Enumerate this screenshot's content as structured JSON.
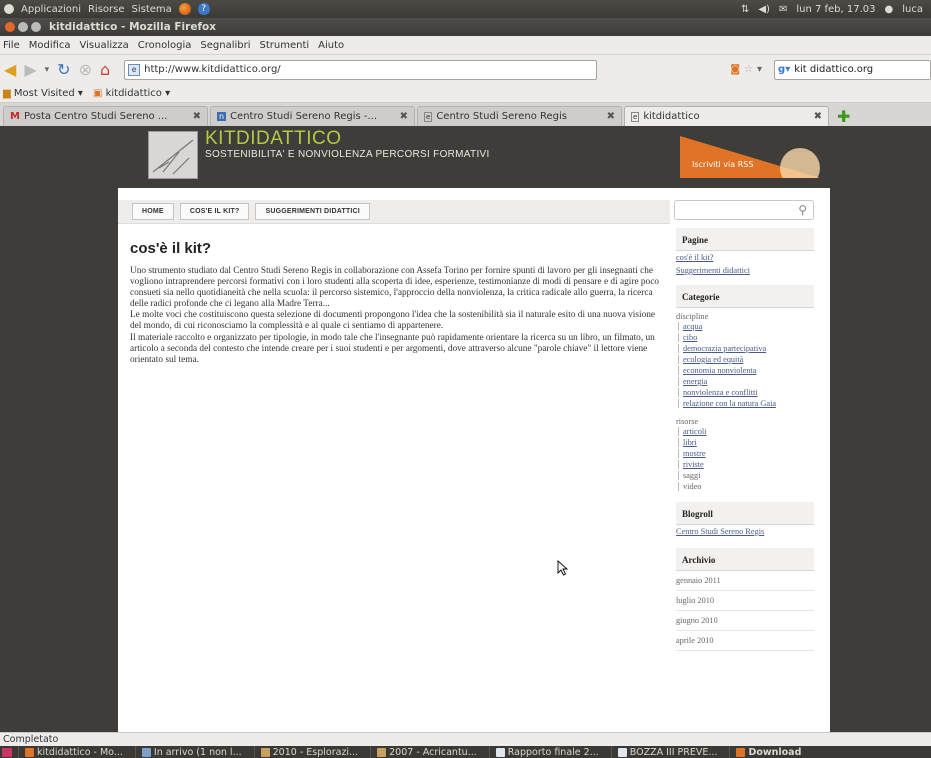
{
  "top_panel": {
    "menus": [
      "Applicazioni",
      "Risorse",
      "Sistema"
    ],
    "clock": "lun 7 feb, 17.03",
    "user": "luca"
  },
  "window": {
    "title": "kitdidattico - Mozilla Firefox"
  },
  "menubar": [
    "File",
    "Modifica",
    "Visualizza",
    "Cronologia",
    "Segnalibri",
    "Strumenti",
    "Aiuto"
  ],
  "navbar": {
    "url": "http://www.kitdidattico.org/",
    "search_value": "kit didattico.org"
  },
  "bookmarks": [
    {
      "label": "Most Visited ▾"
    },
    {
      "label": "kitdidattico ▾"
    }
  ],
  "tabs": [
    {
      "label": "Posta Centro Studi Sereno ...",
      "active": false
    },
    {
      "label": "Centro Studi Sereno Regis -...",
      "active": false
    },
    {
      "label": "Centro Studi Sereno Regis",
      "active": false
    },
    {
      "label": "kitdidattico",
      "active": true
    }
  ],
  "site": {
    "title": "KITDIDATTICO",
    "subtitle": "SOSTENIBILITA' E NONVIOLENZA  PERCORSI FORMATIVI",
    "rss_label": "Iscriviti via RSS",
    "nav": [
      "HOME",
      "COS'E IL KIT?",
      "SUGGERIMENTI DIDATTICI"
    ],
    "page_title": "cos'è il kit?",
    "body_paragraphs": [
      "Uno strumento studiato dal Centro Studi Sereno Regis in collaborazione con Assefa Torino per fornire spunti di lavoro per gli insegnanti che vogliono intraprendere percorsi formativi con i loro studenti alla scoperta di idee, esperienze, testimonianze di modi di pensare e di agire poco consueti sia nello quotidianeità che nella scuola: il percorso sistemico, l'approccio della nonviolenza, la critica radicale allo guerra, la ricerca delle radici profonde che ci legano alla Madre Terra...",
      "Le molte voci che costituiscono questa selezione di documenti propongono l'idea che la sostenibilità sia il naturale esito di una nuova visione del mondo, di cui riconosciamo la complessità e al quale ci sentiamo di appartenere.",
      "Il materiale raccolto e organizzato per tipologie, in modo tale che l'insegnante può rapidamente orientare la ricerca su un libro, un filmato, un articolo a seconda del contesto che intende creare per i suoi studenti e per argomenti, dove attraverso alcune \"parole chiave\" il lettore viene orientato sul tema."
    ],
    "sidebar": {
      "pages_heading": "Pagine",
      "pages": [
        "cos'è il kit?",
        "Suggerimenti didattici"
      ],
      "categories_heading": "Categorie",
      "group_discipline": "discipline",
      "discipline": [
        "acqua",
        "cibo",
        "democrazia partecipativa",
        "ecologia ed equità",
        "economia nonviolenta",
        "energia",
        "nonviolenza e conflitti",
        "relazione con la natura Gaia"
      ],
      "group_risorse": "risorse",
      "risorse": [
        "articoli",
        "libri",
        "mostre",
        "riviste"
      ],
      "risorse_plain": [
        "saggi",
        "video"
      ],
      "blogroll_heading": "Blogroll",
      "blogroll": [
        "Centro Studi Sereno Regis"
      ],
      "archive_heading": "Archivio",
      "archive": [
        "gennaio 2011",
        "luglio 2010",
        "giugno 2010",
        "aprile 2010"
      ]
    }
  },
  "statusbar": {
    "text": "Completato"
  },
  "taskbar": [
    "kitdidattico - Mo...",
    "In arrivo (1 non l...",
    "2010 - Esplorazi...",
    "2007 - Acricantu...",
    "Rapporto finale 2...",
    "BOZZA III PREVE...",
    "Download"
  ],
  "colors": {
    "site_title": "#b8c845",
    "rss": "#e07326",
    "link": "#4a5b8a"
  }
}
